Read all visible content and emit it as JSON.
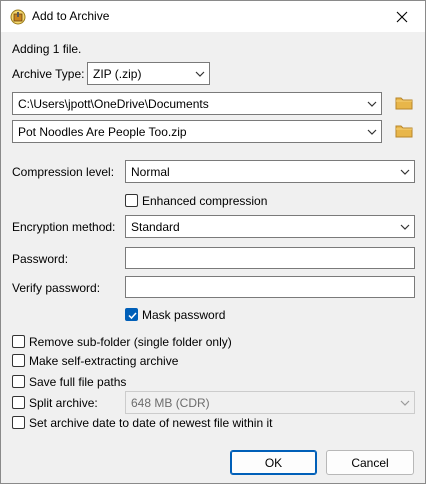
{
  "window": {
    "title": "Add to Archive"
  },
  "info": {
    "adding_text": "Adding 1 file."
  },
  "archive_type": {
    "label": "Archive Type:",
    "value": "ZIP (.zip)"
  },
  "destination": {
    "folder": "C:\\Users\\jpott\\OneDrive\\Documents",
    "filename": "Pot Noodles Are People Too.zip"
  },
  "compression": {
    "label": "Compression level:",
    "value": "Normal",
    "enhanced_label": "Enhanced compression",
    "enhanced_checked": false
  },
  "encryption": {
    "label": "Encryption method:",
    "value": "Standard"
  },
  "password": {
    "label": "Password:",
    "value": "",
    "verify_label": "Verify password:",
    "verify_value": "",
    "mask_label": "Mask password",
    "mask_checked": true
  },
  "options": [
    {
      "label": "Remove sub-folder (single folder only)",
      "checked": false
    },
    {
      "label": "Make self-extracting archive",
      "checked": false
    },
    {
      "label": "Save full file paths",
      "checked": false
    },
    {
      "label": "Split archive:",
      "checked": false
    },
    {
      "label": "Set archive date to date of newest file within it",
      "checked": false
    }
  ],
  "split": {
    "value": "648 MB (CDR)"
  },
  "buttons": {
    "ok": "OK",
    "cancel": "Cancel"
  },
  "icons": {
    "app": "archive-app-icon",
    "close": "close-icon",
    "folder": "folder-icon",
    "dropdown": "chevron-down-icon",
    "check": "check-icon"
  },
  "colors": {
    "accent": "#005fb8",
    "folder": "#e8b64a"
  }
}
